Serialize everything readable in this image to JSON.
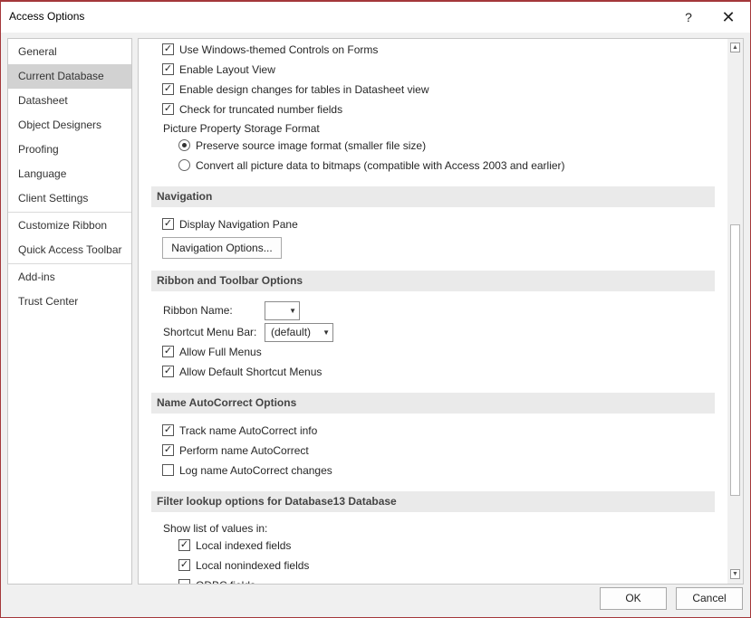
{
  "window": {
    "title": "Access Options",
    "help_glyph": "?",
    "close_glyph": "✕"
  },
  "sidebar": {
    "items": [
      {
        "label": "General"
      },
      {
        "label": "Current Database",
        "selected": true
      },
      {
        "label": "Datasheet"
      },
      {
        "label": "Object Designers"
      },
      {
        "label": "Proofing"
      },
      {
        "label": "Language"
      },
      {
        "label": "Client Settings"
      },
      {
        "label": "Customize Ribbon"
      },
      {
        "label": "Quick Access Toolbar"
      },
      {
        "label": "Add-ins"
      },
      {
        "label": "Trust Center"
      }
    ]
  },
  "content": {
    "top_options": [
      {
        "label": "Use Windows-themed Controls on Forms",
        "checked": true
      },
      {
        "label": "Enable Layout View",
        "checked": true
      },
      {
        "label": "Enable design changes for tables in Datasheet view",
        "checked": true
      },
      {
        "label": "Check for truncated number fields",
        "checked": true
      }
    ],
    "picture_storage": {
      "heading": "Picture Property Storage Format",
      "options": [
        {
          "label": "Preserve source image format (smaller file size)",
          "selected": true
        },
        {
          "label": "Convert all picture data to bitmaps (compatible with Access 2003 and earlier)",
          "selected": false
        }
      ]
    },
    "navigation": {
      "heading": "Navigation",
      "display_pane": {
        "label": "Display Navigation Pane",
        "checked": true
      },
      "options_button": "Navigation Options..."
    },
    "ribbon": {
      "heading": "Ribbon and Toolbar Options",
      "ribbon_name_label": "Ribbon Name:",
      "ribbon_name_value": "",
      "shortcut_label": "Shortcut Menu Bar:",
      "shortcut_value": "(default)",
      "full_menus": {
        "label": "Allow Full Menus",
        "checked": true
      },
      "default_shortcut": {
        "label": "Allow Default Shortcut Menus",
        "checked": true
      }
    },
    "autocorrect": {
      "heading": "Name AutoCorrect Options",
      "items": [
        {
          "label": "Track name AutoCorrect info",
          "checked": true
        },
        {
          "label": "Perform name AutoCorrect",
          "checked": true
        },
        {
          "label": "Log name AutoCorrect changes",
          "checked": false
        }
      ]
    },
    "filter": {
      "heading": "Filter lookup options for Database13 Database",
      "show_list_label": "Show list of values in:",
      "items": [
        {
          "label": "Local indexed fields",
          "checked": true
        },
        {
          "label": "Local nonindexed fields",
          "checked": true
        },
        {
          "label": "ODBC fields",
          "checked": false
        }
      ]
    }
  },
  "footer": {
    "ok_label": "OK",
    "cancel_label": "Cancel"
  }
}
